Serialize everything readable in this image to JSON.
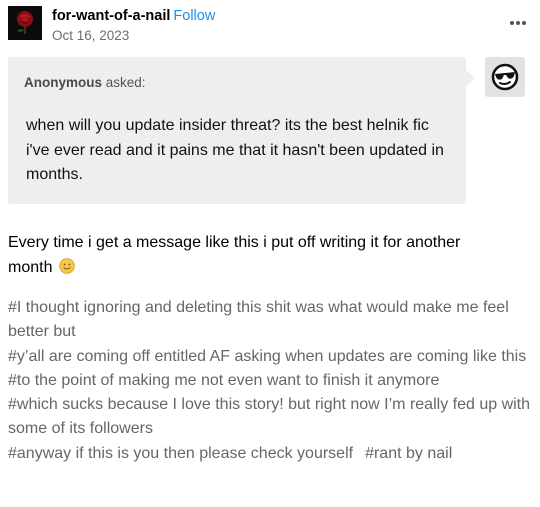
{
  "post": {
    "blog_name": "for-want-of-a-nail",
    "follow_label": "Follow",
    "date": "Oct 16, 2023",
    "more_icon": "more-horizontal-icon"
  },
  "ask": {
    "asker_name": "Anonymous",
    "asked_label": " asked:",
    "question": "when will you update insider threat? its the best helnik fic i've ever read and it pains me that it hasn't been updated in months.",
    "anon_icon": "sunglasses-anon-icon"
  },
  "answer": {
    "text": "Every time i get a message like this i put off writing it for another month",
    "emoji_icon": "smiling-face-emoji-icon"
  },
  "tags": [
    "#I thought ignoring and deleting this shit was what would make me feel better but",
    "#y’all are coming off entitled AF asking when updates are coming like this",
    "#to the point of making me not even want to finish it anymore",
    "#which sucks because I love this story! but right now I’m really fed up with some of its followers",
    "#anyway if this is you then please check yourself",
    "#rant by nail"
  ],
  "colors": {
    "follow": "#1d8fe8",
    "tag_text": "#666666",
    "ask_background": "#eeeeee"
  }
}
